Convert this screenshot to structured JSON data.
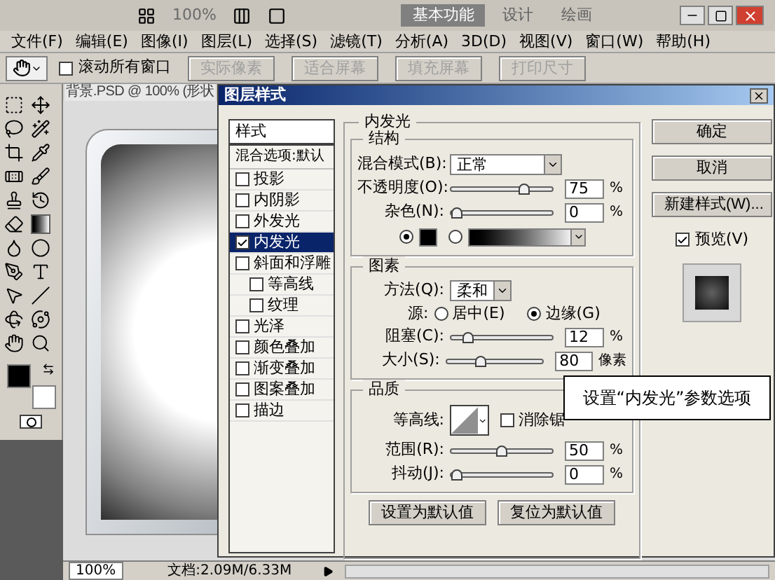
{
  "title_bar": {
    "zoom": {
      "label": "100%",
      "disabled": true
    },
    "workspaces": [
      {
        "label": "基本功能",
        "selected": true
      },
      {
        "label": "设计",
        "selected": false
      },
      {
        "label": "绘画",
        "selected": false
      }
    ]
  },
  "menu_bar": [
    "文件(F)",
    "编辑(E)",
    "图像(I)",
    "图层(L)",
    "选择(S)",
    "滤镜(T)",
    "分析(A)",
    "3D(D)",
    "视图(V)",
    "窗口(W)",
    "帮助(H)"
  ],
  "options_bar": {
    "scroll_all": {
      "label": "滚动所有窗口",
      "checked": false
    },
    "buttons": [
      {
        "label": "实际像素",
        "disabled": true
      },
      {
        "label": "适合屏幕",
        "disabled": true
      },
      {
        "label": "填充屏幕",
        "disabled": true
      },
      {
        "label": "打印尺寸",
        "disabled": true
      }
    ]
  },
  "document": {
    "tab": "背景.PSD @ 100% (形状",
    "status_zoom": "100%",
    "doc_info": "文档:2.09M/6.33M"
  },
  "dialog": {
    "title": "图层样式",
    "styles_header": "样式",
    "blend_options": "混合选项:默认",
    "styles": [
      {
        "label": "投影",
        "checked": false,
        "selected": false
      },
      {
        "label": "内阴影",
        "checked": false,
        "selected": false
      },
      {
        "label": "外发光",
        "checked": false,
        "selected": false
      },
      {
        "label": "内发光",
        "checked": true,
        "selected": true
      },
      {
        "label": "斜面和浮雕",
        "checked": false,
        "selected": false,
        "children": [
          {
            "label": "等高线",
            "checked": false,
            "selected": false
          },
          {
            "label": "纹理",
            "checked": false,
            "selected": false
          }
        ]
      },
      {
        "label": "光泽",
        "checked": false,
        "selected": false
      },
      {
        "label": "颜色叠加",
        "checked": false,
        "selected": false
      },
      {
        "label": "渐变叠加",
        "checked": false,
        "selected": false
      },
      {
        "label": "图案叠加",
        "checked": false,
        "selected": false
      },
      {
        "label": "描边",
        "checked": false,
        "selected": false
      }
    ],
    "panel_title": "内发光",
    "structure": {
      "title": "结构",
      "blend_mode": {
        "label": "混合模式(B):",
        "value": "正常"
      },
      "opacity": {
        "label": "不透明度(O):",
        "level": 0.75,
        "value": "75",
        "unit": "%"
      },
      "noise": {
        "label": "杂色(N):",
        "level": 0,
        "value": "0",
        "unit": "%"
      },
      "fill": [
        {
          "kind": "color",
          "selected": true
        },
        {
          "kind": "gradient",
          "selected": false
        }
      ]
    },
    "elements": {
      "title": "图素",
      "technique": {
        "label": "方法(Q):",
        "value": "柔和"
      },
      "source": {
        "label": "源:",
        "options": [
          {
            "label": "居中(E)",
            "selected": false
          },
          {
            "label": "边缘(G)",
            "selected": true
          }
        ]
      },
      "choke": {
        "label": "阻塞(C):",
        "level": 0.12,
        "value": "12",
        "unit": "%"
      },
      "size": {
        "label": "大小(S):",
        "level": 0.33,
        "value": "80",
        "unit": "像素"
      }
    },
    "quality": {
      "title": "品质",
      "contour": {
        "label": "等高线:"
      },
      "anti_alias": {
        "label": "消除锯",
        "checked": false
      },
      "range": {
        "label": "范围(R):",
        "level": 0.5,
        "value": "50",
        "unit": "%"
      },
      "jitter": {
        "label": "抖动(J):",
        "level": 0,
        "value": "0",
        "unit": "%"
      }
    },
    "default_buttons": [
      "设置为默认值",
      "复位为默认值"
    ],
    "actions": [
      "确定",
      "取消",
      "新建样式(W)..."
    ],
    "preview": {
      "label": "预览(V)",
      "checked": true
    }
  },
  "callout": "设置“内发光”参数选项"
}
